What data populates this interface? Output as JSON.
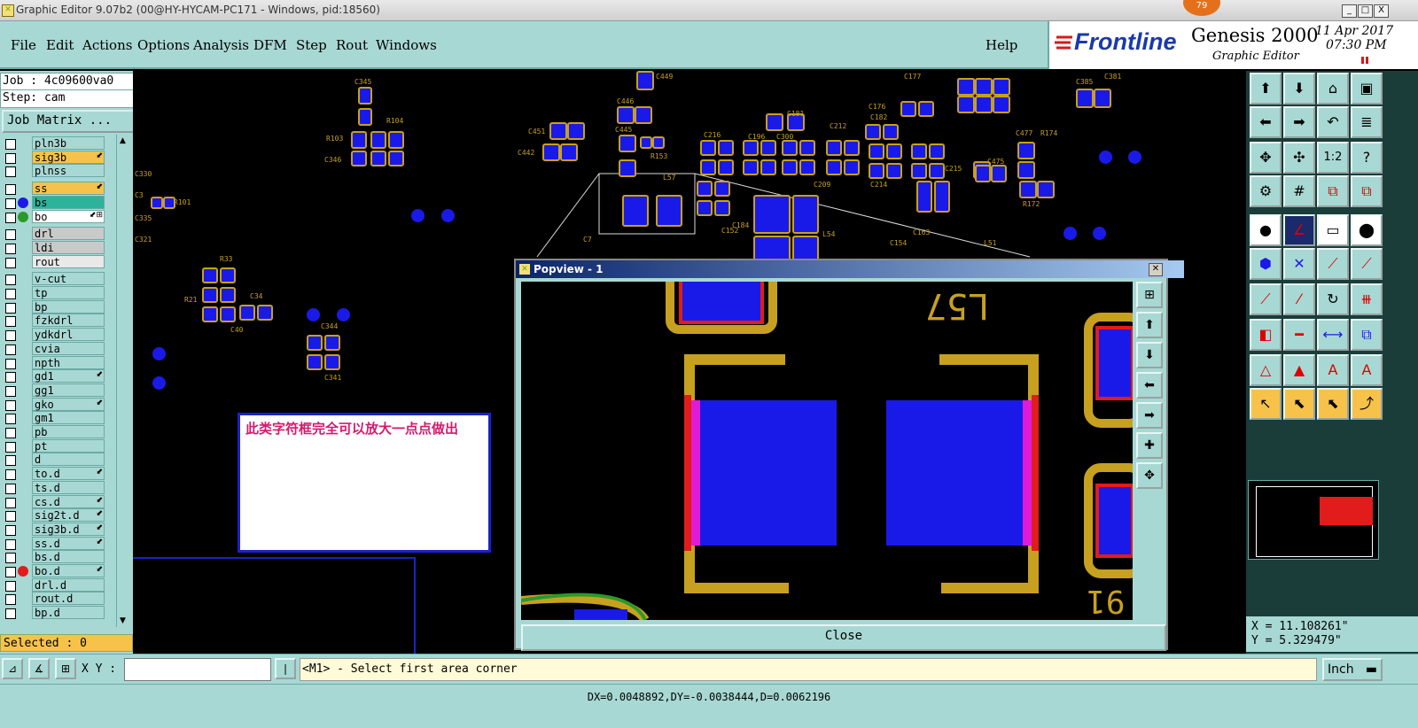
{
  "window": {
    "title": "Graphic Editor 9.07b2 (00@HY-HYCAM-PC171 - Windows, pid:18560)",
    "badge": "79",
    "controls": [
      "_",
      "□",
      "X"
    ]
  },
  "menu": {
    "items": [
      {
        "label": "File"
      },
      {
        "label": "Edit"
      },
      {
        "label": "Actions"
      },
      {
        "label": "Options"
      },
      {
        "label": "Analysis"
      },
      {
        "label": "DFM"
      },
      {
        "label": "Step"
      },
      {
        "label": "Rout"
      },
      {
        "label": "Windows"
      }
    ],
    "help": "Help"
  },
  "brand": {
    "logo": "Frontline",
    "product": "Genesis 2000",
    "subtitle": "Graphic Editor",
    "date": "11 Apr 2017",
    "time": "07:30 PM",
    "accent": "#d21b1b"
  },
  "left_panel": {
    "job": "Job : 4c09600va0",
    "step": "Step: cam",
    "job_matrix": "Job Matrix ...",
    "selected": "Selected : 0",
    "layers": [
      {
        "name": "pln3b",
        "color": "#a8d8d3",
        "dot": ""
      },
      {
        "name": "sig3b",
        "color": "#f6c24a",
        "dot": "",
        "mark": "⬋"
      },
      {
        "name": "plnss",
        "color": "#a8d8d3",
        "dot": ""
      },
      {
        "name": "ss",
        "color": "#f6c24a",
        "dot": "",
        "mark": "⬋"
      },
      {
        "name": "bs",
        "color": "#2db39b",
        "dot": "#1a1ae8"
      },
      {
        "name": "bo",
        "color": "#ffffff",
        "dot": "#2a9a2a",
        "mark": "⬋⊞"
      },
      {
        "name": "drl",
        "color": "#c9c9c9",
        "dot": ""
      },
      {
        "name": "ldi",
        "color": "#c9c9c9",
        "dot": ""
      },
      {
        "name": "rout",
        "color": "#e9e9e9",
        "dot": ""
      },
      {
        "name": "v-cut",
        "color": "#a8d8d3",
        "dot": ""
      },
      {
        "name": "tp",
        "color": "#a8d8d3",
        "dot": ""
      },
      {
        "name": "bp",
        "color": "#a8d8d3",
        "dot": ""
      },
      {
        "name": "fzkdrl",
        "color": "#a8d8d3",
        "dot": ""
      },
      {
        "name": "ydkdrl",
        "color": "#a8d8d3",
        "dot": ""
      },
      {
        "name": "cvia",
        "color": "#a8d8d3",
        "dot": ""
      },
      {
        "name": "npth",
        "color": "#a8d8d3",
        "dot": ""
      },
      {
        "name": "gd1",
        "color": "#a8d8d3",
        "dot": "",
        "mark": "⬋"
      },
      {
        "name": "gg1",
        "color": "#a8d8d3",
        "dot": ""
      },
      {
        "name": "gko",
        "color": "#a8d8d3",
        "dot": "",
        "mark": "⬋"
      },
      {
        "name": "gm1",
        "color": "#a8d8d3",
        "dot": ""
      },
      {
        "name": "pb",
        "color": "#a8d8d3",
        "dot": ""
      },
      {
        "name": "pt",
        "color": "#a8d8d3",
        "dot": ""
      },
      {
        "name": "d",
        "color": "#a8d8d3",
        "dot": ""
      },
      {
        "name": "to.d",
        "color": "#a8d8d3",
        "dot": "",
        "mark": "⬋"
      },
      {
        "name": "ts.d",
        "color": "#a8d8d3",
        "dot": ""
      },
      {
        "name": "cs.d",
        "color": "#a8d8d3",
        "dot": "",
        "mark": "⬋"
      },
      {
        "name": "sig2t.d",
        "color": "#a8d8d3",
        "dot": "",
        "mark": "⬋"
      },
      {
        "name": "sig3b.d",
        "color": "#a8d8d3",
        "dot": "",
        "mark": "⬋"
      },
      {
        "name": "ss.d",
        "color": "#a8d8d3",
        "dot": "",
        "mark": "⬋"
      },
      {
        "name": "bs.d",
        "color": "#a8d8d3",
        "dot": ""
      },
      {
        "name": "bo.d",
        "color": "#a8d8d3",
        "dot": "#e21b1b",
        "mark": "⬋"
      },
      {
        "name": "drl.d",
        "color": "#a8d8d3",
        "dot": ""
      },
      {
        "name": "rout.d",
        "color": "#a8d8d3",
        "dot": ""
      },
      {
        "name": "bp.d",
        "color": "#a8d8d3",
        "dot": ""
      }
    ]
  },
  "canvas": {
    "note": "此类字符框完全可以放大一点点做出",
    "labels": [
      "C345",
      "R104",
      "R103",
      "C346",
      "R101",
      "C330",
      "C3",
      "C335",
      "C321",
      "R33",
      "R21",
      "C34",
      "C40",
      "C344",
      "C341",
      "C446",
      "C451",
      "C442",
      "C445",
      "R153",
      "C449",
      "C216",
      "C196",
      "C300",
      "C209",
      "C212",
      "C182",
      "C214",
      "C176",
      "C177",
      "C215",
      "C475",
      "C477",
      "R174",
      "R172",
      "C385",
      "C381",
      "L57",
      "L54",
      "C184",
      "C163",
      "C181",
      "C154",
      "C152",
      "C7",
      "L51"
    ]
  },
  "popview": {
    "title": "Popview - 1",
    "label_top": "L57",
    "label_bottom": "91",
    "close": "Close"
  },
  "coords": {
    "x": "X = 11.108261\"",
    "y": "Y = 5.329479\""
  },
  "command": {
    "xy_label": "X Y :",
    "input_value": "",
    "prompt": "<M1> - Select first area corner",
    "units": "Inch"
  },
  "status": {
    "text": "DX=0.0048892,DY=-0.0038444,D=0.0062196"
  },
  "colors": {
    "panel": "#a8d8d3",
    "copper": "#1a1ae8",
    "silk": "#c8a020",
    "highlight": "#f6c24a"
  }
}
